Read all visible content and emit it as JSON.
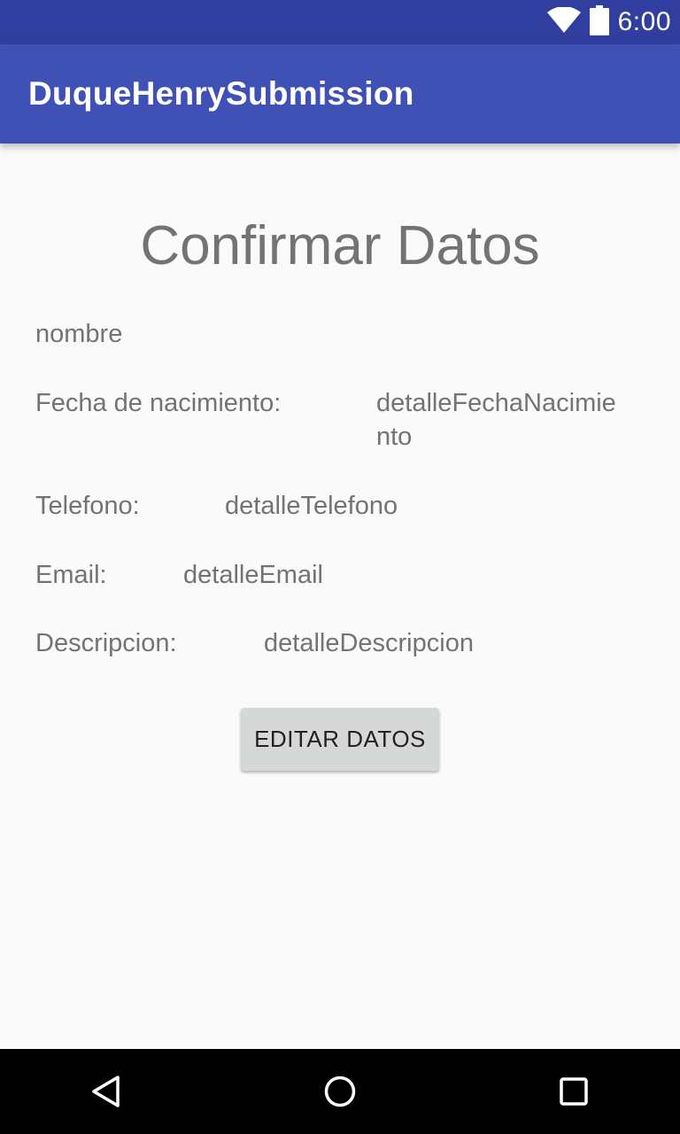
{
  "status_bar": {
    "time": "6:00"
  },
  "app_bar": {
    "title": "DuqueHenrySubmission"
  },
  "screen": {
    "title": "Confirmar Datos",
    "name_value": "nombre",
    "birthdate_label": "Fecha de nacimiento:",
    "birthdate_value_line1": "detalleFechaNacimie",
    "birthdate_value_line2": "nto",
    "phone_label": "Telefono:",
    "phone_value": "detalleTelefono",
    "email_label": "Email:",
    "email_value": "detalleEmail",
    "description_label": "Descripcion:",
    "description_value": "detalleDescripcion",
    "edit_button": "EDITAR DATOS"
  },
  "colors": {
    "status_bar": "#303f9f",
    "app_bar": "#3f51b5",
    "background": "#fafafa",
    "text_gray": "#737373",
    "button": "#d6d7d7"
  },
  "icons": {
    "wifi": "wifi-icon",
    "battery": "battery-icon",
    "back": "nav-back-icon",
    "home": "nav-home-icon",
    "recents": "nav-recents-icon"
  }
}
